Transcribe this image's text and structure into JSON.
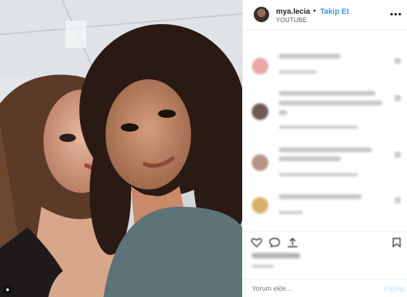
{
  "post": {
    "username": "mya.lecia",
    "separator": "•",
    "follow_label": "Takip Et",
    "subtitle": "YOUTUBE",
    "more_icon": "more-horizontal-icon"
  },
  "comments": [
    {
      "avatar_color": "#e7a7a4"
    },
    {
      "avatar_color": "#6e5a4e"
    },
    {
      "avatar_color": "#b59484"
    },
    {
      "avatar_color": "#d8b26a"
    }
  ],
  "actions": {
    "icons": [
      "heart-icon",
      "comment-icon",
      "share-icon",
      "bookmark-icon"
    ]
  },
  "composer": {
    "placeholder": "Yorum ekle...",
    "share_label": "Paylaş"
  },
  "colors": {
    "accent": "#3897f0",
    "text": "#262626",
    "border": "#efefef"
  }
}
